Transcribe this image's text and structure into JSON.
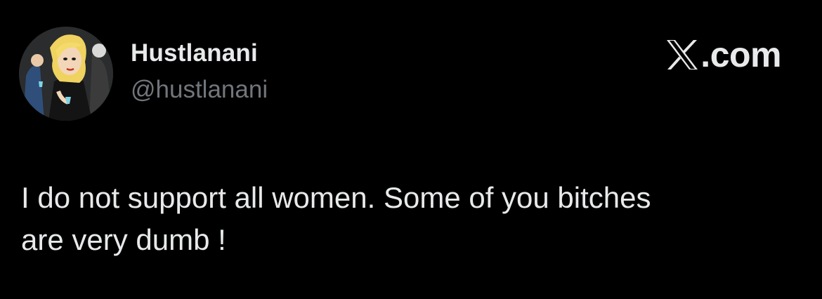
{
  "tweet": {
    "author": {
      "display_name": "Hustlanani",
      "handle": "@hustlanani",
      "avatar_icon": "cartoon-avatar-icon"
    },
    "brand": {
      "logo_icon": "x-logo-icon",
      "suffix": ".com"
    },
    "text_lines": [
      "I do not support all women. Some of you bitches",
      "are very dumb !"
    ]
  },
  "colors": {
    "background": "#000000",
    "primary_text": "#e7e9ea",
    "secondary_text": "#71767b"
  }
}
